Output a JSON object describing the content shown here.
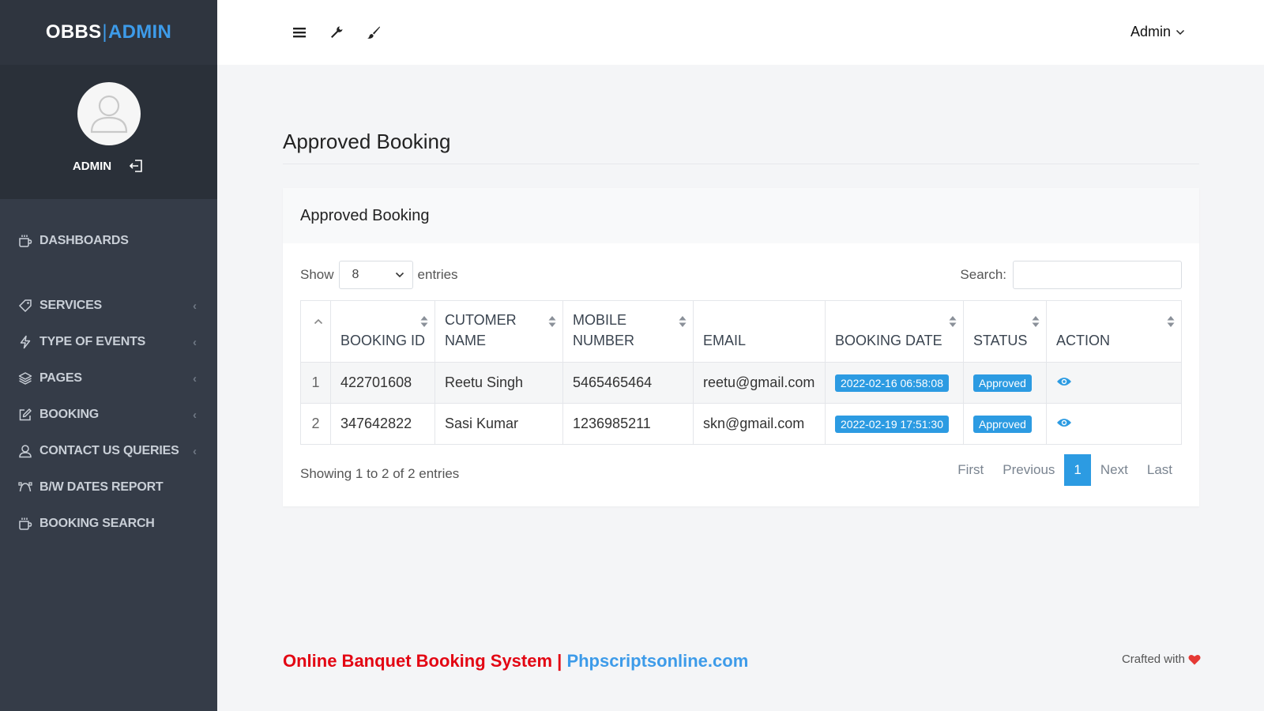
{
  "brand": {
    "part1": "OBBS",
    "separator": "|",
    "part2": "ADMIN"
  },
  "profile": {
    "name": "ADMIN"
  },
  "sidebar": {
    "items": [
      {
        "label": "DASHBOARDS",
        "icon": "coffee-cup-icon",
        "has_chevron": false
      },
      {
        "label": "SERVICES",
        "icon": "tags-icon",
        "has_chevron": true
      },
      {
        "label": "TYPE OF EVENTS",
        "icon": "lightning-icon",
        "has_chevron": true
      },
      {
        "label": "PAGES",
        "icon": "layers-icon",
        "has_chevron": true
      },
      {
        "label": "BOOKING",
        "icon": "edit-icon",
        "has_chevron": true
      },
      {
        "label": "CONTACT US QUERIES",
        "icon": "user-icon",
        "has_chevron": true
      },
      {
        "label": "B/W DATES REPORT",
        "icon": "curve-icon",
        "has_chevron": false
      },
      {
        "label": "BOOKING SEARCH",
        "icon": "coffee-cup-icon",
        "has_chevron": false
      }
    ]
  },
  "topbar": {
    "user_label": "Admin"
  },
  "page": {
    "title": "Approved Booking"
  },
  "card": {
    "title": "Approved Booking"
  },
  "datatable": {
    "show_label": "Show",
    "entries_value": "8",
    "entries_label": "entries",
    "search_label": "Search:",
    "search_value": "",
    "columns": [
      "",
      "BOOKING ID",
      "CUTOMER NAME",
      "MOBILE NUMBER",
      "EMAIL",
      "BOOKING DATE",
      "STATUS",
      "ACTION"
    ],
    "rows": [
      {
        "index": "1",
        "booking_id": "422701608",
        "customer_name": "Reetu Singh",
        "mobile": "5465465464",
        "email": "reetu@gmail.com",
        "booking_date": "2022-02-16 06:58:08",
        "status": "Approved"
      },
      {
        "index": "2",
        "booking_id": "347642822",
        "customer_name": "Sasi Kumar",
        "mobile": "1236985211",
        "email": "skn@gmail.com",
        "booking_date": "2022-02-19 17:51:30",
        "status": "Approved"
      }
    ],
    "info": "Showing 1 to 2 of 2 entries",
    "pagination": {
      "first": "First",
      "previous": "Previous",
      "current": "1",
      "next": "Next",
      "last": "Last"
    }
  },
  "footer": {
    "left_red": "Online Banquet Booking System | ",
    "left_blue": "Phpscriptsonline.com",
    "right": "Crafted with"
  },
  "colors": {
    "accent": "#2c9be2",
    "sidebar_bg": "#353c48",
    "footer_red": "#e30613"
  }
}
